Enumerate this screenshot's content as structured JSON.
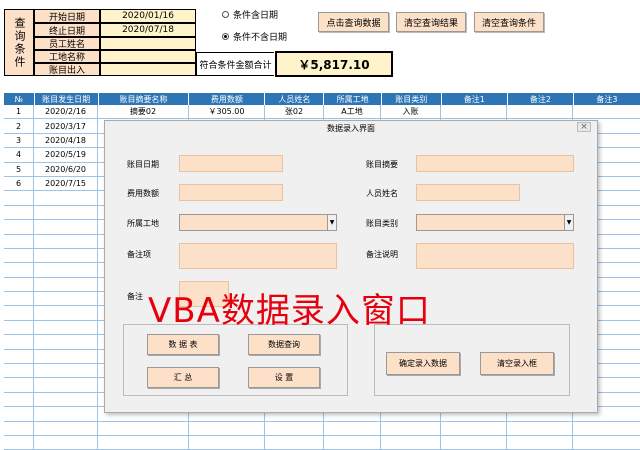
{
  "query_panel": {
    "side_label": "查询条件",
    "fields": [
      {
        "label": "开始日期",
        "value": "2020/01/16"
      },
      {
        "label": "终止日期",
        "value": "2020/07/18"
      },
      {
        "label": "员工姓名",
        "value": ""
      },
      {
        "label": "工地名称",
        "value": ""
      },
      {
        "label": "账目出入",
        "value": ""
      }
    ],
    "radio_include": "条件含日期",
    "radio_exclude": "条件不含日期",
    "btn_query": "点击查询数据",
    "btn_clear_results": "清空查询结果",
    "btn_clear_conditions": "清空查询条件",
    "sum_label": "符合条件金额合计",
    "sum_value": "￥5,817.10"
  },
  "table": {
    "headers": [
      "№",
      "账目发生日期",
      "账目摘要名称",
      "费用数额",
      "人员姓名",
      "所属工地",
      "账目类别",
      "备注1",
      "备注2",
      "备注3"
    ],
    "rows": [
      [
        "1",
        "2020/2/16",
        "摘要02",
        "￥305.00",
        "张02",
        "A工地",
        "入账",
        "",
        "",
        ""
      ],
      [
        "2",
        "2020/3/17",
        "",
        "",
        "",
        "",
        "",
        "",
        "",
        ""
      ],
      [
        "3",
        "2020/4/18",
        "",
        "",
        "",
        "",
        "",
        "",
        "",
        ""
      ],
      [
        "4",
        "2020/5/19",
        "",
        "",
        "",
        "",
        "",
        "",
        "",
        ""
      ],
      [
        "5",
        "2020/6/20",
        "",
        "",
        "",
        "",
        "",
        "",
        "",
        ""
      ],
      [
        "6",
        "2020/7/15",
        "",
        "",
        "",
        "",
        "",
        "",
        "",
        ""
      ]
    ]
  },
  "dialog": {
    "title": "数据录入界面",
    "close": "×",
    "labels": {
      "date": "账目日期",
      "summary": "账目摘要",
      "amount": "费用数额",
      "person": "人员姓名",
      "site": "所属工地",
      "category": "账目类别",
      "remark_item": "备注项",
      "remark_desc": "备注说明",
      "remark": "备注"
    },
    "buttons": {
      "data_table": "数 据 表",
      "data_query": "数据查询",
      "summary": "汇 总",
      "settings": "设 置",
      "confirm_entry": "确定录入数据",
      "clear_entry": "清空录入框"
    }
  },
  "overlay_text": "VBA数据录入窗口"
}
